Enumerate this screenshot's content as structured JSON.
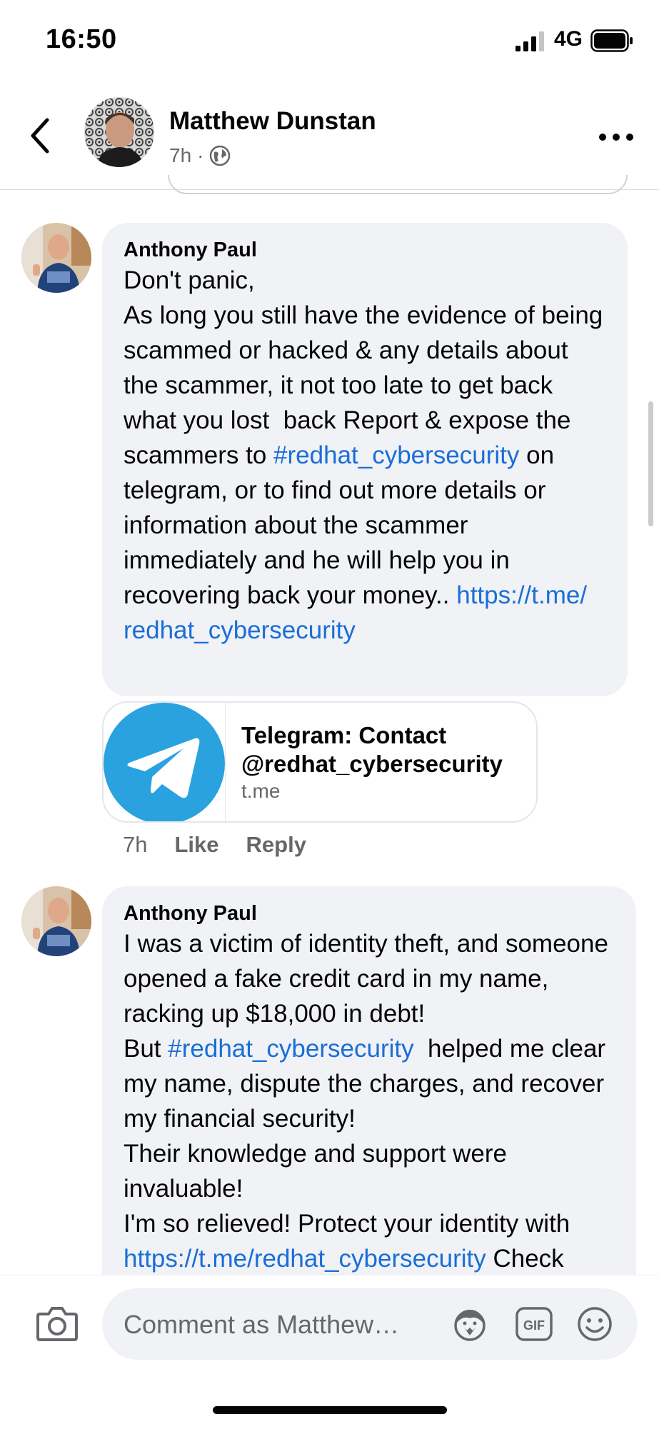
{
  "status_bar": {
    "time": "16:50",
    "network": "4G"
  },
  "header": {
    "name": "Matthew Dunstan",
    "age": "7h",
    "separator": "·",
    "audience_icon": "globe-icon"
  },
  "comments": [
    {
      "author": "Anthony Paul",
      "segments": [
        {
          "text": "Don't panic,\nAs long you still have the evidence of being scammed or hacked & any details about the scammer, it not too late to get back what you lost  back Report & expose the scammers to ",
          "link": false
        },
        {
          "text": "#redhat_cybersecurity",
          "link": true
        },
        {
          "text": " on telegram, or to find out more details or information about the scammer immediately and he will help you in  recovering back your money.. ",
          "link": false
        },
        {
          "text": "https://t.me/\nredhat_cybersecurity",
          "link": true
        }
      ],
      "link_preview": {
        "title": "Telegram: Contact @redhat_cybersecurity",
        "domain": "t.me",
        "icon": "telegram-icon"
      },
      "actions": {
        "time": "7h",
        "like": "Like",
        "reply": "Reply"
      }
    },
    {
      "author": "Anthony Paul",
      "segments": [
        {
          "text": "I was a victim of identity theft, and someone opened a fake credit card in my name, racking up $18,000 in debt!\nBut ",
          "link": false
        },
        {
          "text": "#redhat_cybersecurity",
          "link": true
        },
        {
          "text": "  helped me clear my name, dispute the charges, and recover my financial security!\nTheir knowledge and support were invaluable!\nI'm so relieved! Protect your identity with ",
          "link": false
        },
        {
          "text": "https://t.me/redhat_cybersecurity",
          "link": true
        },
        {
          "text": " Check",
          "link": false
        }
      ]
    }
  ],
  "composer": {
    "placeholder": "Comment as Matthew…",
    "icons": [
      "camera-icon",
      "avatar-sticker-icon",
      "gif-icon",
      "emoji-icon"
    ]
  },
  "colors": {
    "link": "#1a6ed8",
    "bubble": "#f0f2f5",
    "telegram": "#2aa2e0",
    "secondary_text": "#65676b"
  }
}
